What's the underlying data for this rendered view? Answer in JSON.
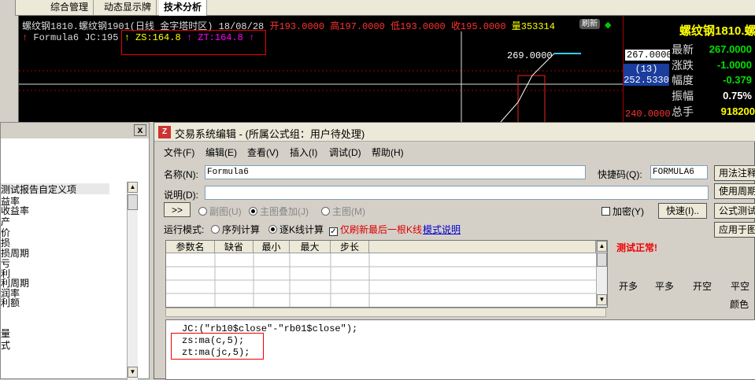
{
  "tabs": {
    "items": [
      "综合管理",
      "动态显示牌",
      "技术分析"
    ],
    "active": "技术分析"
  },
  "chart": {
    "header": "螺纹钢1810.螺纹钢1901(日线 金字塔时区) 18/08/28",
    "open": "开193.0000",
    "high": "高197.0000",
    "low": "低193.0000",
    "close": "收195.0000",
    "volume": "量353314",
    "refresh_label": "刷新",
    "formula_line": "Formula6 JC:195",
    "zs_label": "ZS:164.8",
    "zt_label": "ZT:164.8",
    "price_tag": "269.0000"
  },
  "price_axis": {
    "top_price": "267.0000",
    "count": "(13)",
    "mid_price": "252.5330",
    "low_price": "240.0000"
  },
  "quote": {
    "title": "螺纹钢1810.螺",
    "rows": [
      {
        "label": "最新",
        "value": "267.0000",
        "color": "#00e000"
      },
      {
        "label": "涨跌",
        "value": "-1.0000",
        "color": "#00e000"
      },
      {
        "label": "幅度",
        "value": "-0.379",
        "color": "#00e000"
      },
      {
        "label": "振幅",
        "value": "0.75%",
        "color": "#ffffff"
      },
      {
        "label": "总手",
        "value": "918200",
        "color": "#ffff00"
      }
    ]
  },
  "left_panel": {
    "close_label": "x",
    "items": [
      "测试报告自定义项",
      "益率",
      "收益率",
      "产",
      "价",
      "损",
      "损周期",
      "亏",
      "利",
      "利周期",
      "润率",
      "利额",
      "量",
      "式"
    ]
  },
  "dialog": {
    "title": "交易系统编辑 - (所属公式组：用户待处理)",
    "menu": [
      "文件(F)",
      "编辑(E)",
      "查看(V)",
      "插入(I)",
      "调试(D)",
      "帮助(H)"
    ],
    "name_label": "名称(N):",
    "name_value": "Formula6",
    "shortcut_label": "快捷码(Q):",
    "shortcut_value": "FORMULA6",
    "desc_label": "说明(D):",
    "expand_label": ">>",
    "chart_modes": [
      "副图(U)",
      "主图叠加(J)",
      "主图(M)"
    ],
    "encrypt_label": "加密(Y)",
    "quick_label": "快速(I)..",
    "right_buttons": [
      "用法注释",
      "使用周期",
      "公式测试",
      "应用于图"
    ],
    "run_mode_label": "运行模式:",
    "run_modes": [
      "序列计算",
      "逐K线计算"
    ],
    "refresh_last_label": "仅刷新最后一根K线",
    "mode_help_label": "模式说明",
    "param_headers": [
      "参数名",
      "缺省",
      "最小",
      "最大",
      "步长"
    ],
    "test_status": "测试正常!",
    "trade_tabs": [
      "开多",
      "平多",
      "开空",
      "平空"
    ],
    "color_label": "颜色",
    "code_lines": [
      "JC:(\"rb10$close\"-\"rb01$close\");",
      "zs:ma(c,5);",
      "zt:ma(jc,5);"
    ]
  }
}
